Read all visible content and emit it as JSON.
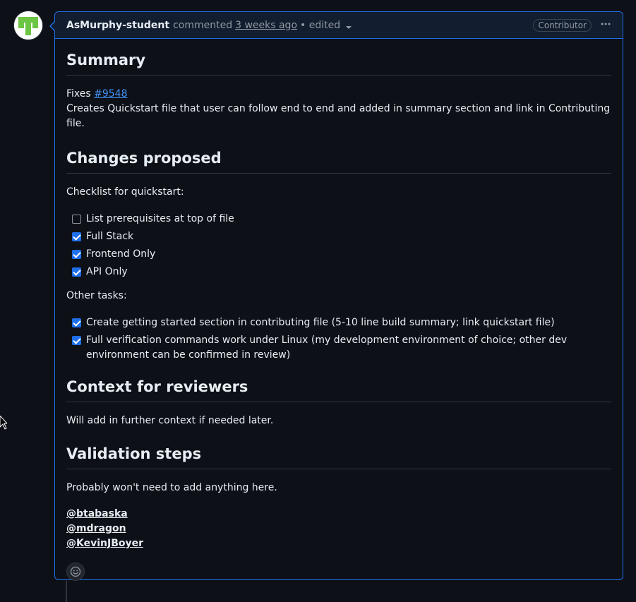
{
  "comment": {
    "author": "AsMurphy-student",
    "action": "commented",
    "time": "3 weeks ago",
    "edited": "• edited",
    "badge": "Contributor",
    "menu_icon": "kebab-horizontal-icon",
    "avatar_icon": "identicon-avatar"
  },
  "colors": {
    "accent": "#1f6feb",
    "link": "#4493f8",
    "avatar_green": "#6cc644",
    "background": "#0d1117"
  },
  "summary": {
    "heading": "Summary",
    "fixes_label": "Fixes",
    "issue_link": "#9548",
    "description": "Creates Quickstart file that user can follow end to end and added in summary section and link in Contributing file."
  },
  "changes": {
    "heading": "Changes proposed",
    "checklist_intro": "Checklist for quickstart:",
    "checklist": [
      {
        "label": "List prerequisites at top of file",
        "checked": false
      },
      {
        "label": "Full Stack",
        "checked": true
      },
      {
        "label": "Frontend Only",
        "checked": true
      },
      {
        "label": "API Only",
        "checked": true
      }
    ],
    "other_intro": "Other tasks:",
    "other_tasks": [
      {
        "label": "Create getting started section in contributing file (5-10 line build summary; link quickstart file)",
        "checked": true
      },
      {
        "label": "Full verification commands work under Linux (my development environment of choice; other dev environment can be confirmed in review)",
        "checked": true
      }
    ]
  },
  "context": {
    "heading": "Context for reviewers",
    "text": "Will add in further context if needed later."
  },
  "validation": {
    "heading": "Validation steps",
    "text": "Probably won't need to add anything here."
  },
  "mentions": [
    "@btabaska",
    "@mdragon",
    "@KevinJBoyer"
  ],
  "reaction_icon": "smiley-icon"
}
